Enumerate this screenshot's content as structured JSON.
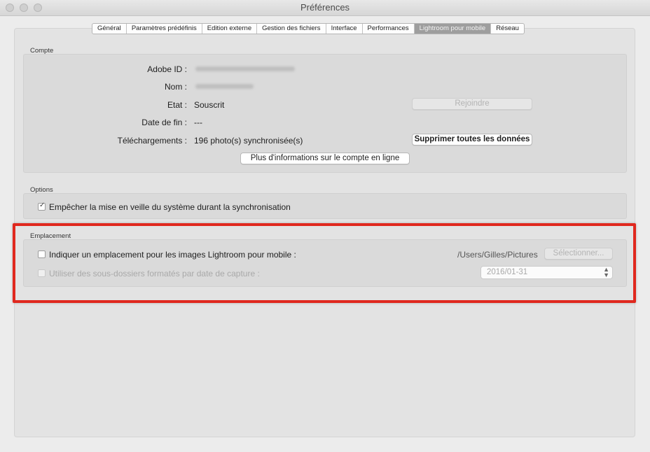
{
  "window": {
    "title": "Préférences"
  },
  "tabs": [
    {
      "label": "Général"
    },
    {
      "label": "Paramètres prédéfinis"
    },
    {
      "label": "Edition externe"
    },
    {
      "label": "Gestion des fichiers"
    },
    {
      "label": "Interface"
    },
    {
      "label": "Performances"
    },
    {
      "label": "Lightroom pour mobile",
      "active": true
    },
    {
      "label": "Réseau"
    }
  ],
  "account": {
    "section_label": "Compte",
    "adobe_id_label": "Adobe ID :",
    "name_label": "Nom :",
    "state_label": "Etat :",
    "state_value": "Souscrit",
    "end_date_label": "Date de fin :",
    "end_date_value": "---",
    "downloads_label": "Téléchargements :",
    "downloads_value": "196 photo(s) synchronisée(s)",
    "join_button": "Rejoindre",
    "delete_button": "Supprimer toutes les données",
    "more_info_button": "Plus d'informations sur le compte en ligne"
  },
  "options": {
    "section_label": "Options",
    "prevent_sleep_label": "Empêcher la mise en veille du système durant la synchronisation",
    "prevent_sleep_checked": true
  },
  "location": {
    "section_label": "Emplacement",
    "specify_location_label": "Indiquer un emplacement pour les images Lightroom pour mobile :",
    "specify_location_checked": false,
    "path": "/Users/Gilles/Pictures",
    "select_button": "Sélectionner...",
    "subfolders_label": "Utiliser des sous-dossiers formatés par date de capture :",
    "subfolders_checked": false,
    "date_format": "2016/01-31"
  },
  "colors": {
    "highlight": "#e0281e",
    "active_tab": "#9e9e9e"
  },
  "icons": {
    "checkmark": "checkmark-icon",
    "select_arrows": "up-down-chevron-icon"
  }
}
